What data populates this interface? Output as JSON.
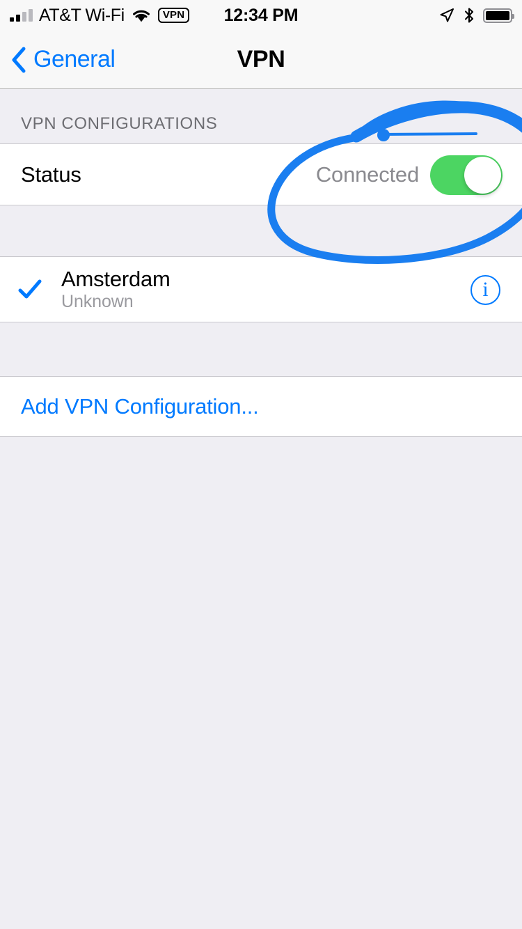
{
  "status_bar": {
    "carrier": "AT&T Wi-Fi",
    "time": "12:34 PM",
    "vpn_badge": "VPN",
    "signal_bars_filled": 2,
    "signal_bars_total": 4,
    "icons": {
      "wifi": "wifi-icon",
      "location": "location-arrow-icon",
      "bluetooth": "bluetooth-icon",
      "battery": "battery-full-icon"
    }
  },
  "nav": {
    "back_label": "General",
    "back_icon": "chevron-left-icon",
    "title": "VPN"
  },
  "sections": {
    "configurations_header": "VPN CONFIGURATIONS",
    "status_row": {
      "label": "Status",
      "value": "Connected",
      "toggle_on": true
    },
    "configs": [
      {
        "name": "Amsterdam",
        "subtitle": "Unknown",
        "selected": true,
        "info_glyph": "i"
      }
    ],
    "add_config_label": "Add VPN Configuration..."
  },
  "annotation": {
    "type": "hand-drawn-circle",
    "color": "#1A7EF0",
    "target": "Status / Connected toggle"
  },
  "colors": {
    "accent_blue": "#007AFF",
    "toggle_green": "#4CD562",
    "group_background": "#FFFFFF",
    "page_background": "#EFEEF3",
    "separator": "#C8C7CC",
    "secondary_text": "#8A8A8F",
    "header_text": "#6D6D72"
  }
}
